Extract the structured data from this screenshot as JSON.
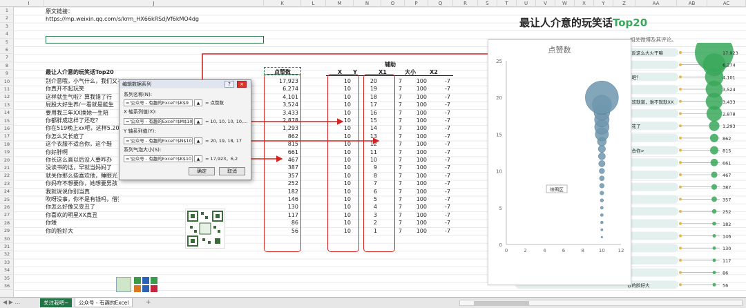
{
  "columns": [
    {
      "label": "I",
      "x": 20,
      "w": 44
    },
    {
      "label": "J",
      "x": 64,
      "w": 318
    },
    {
      "label": "K",
      "x": 382,
      "w": 54
    },
    {
      "label": "L",
      "x": 436,
      "w": 36
    },
    {
      "label": "M",
      "x": 472,
      "w": 40
    },
    {
      "label": "N",
      "x": 512,
      "w": 40
    },
    {
      "label": "O",
      "x": 552,
      "w": 34
    },
    {
      "label": "P",
      "x": 586,
      "w": 34
    },
    {
      "label": "Q",
      "x": 620,
      "w": 36
    },
    {
      "label": "R",
      "x": 656,
      "w": 36
    },
    {
      "label": "S",
      "x": 692,
      "w": 28
    },
    {
      "label": "T",
      "x": 720,
      "w": 28
    },
    {
      "label": "U",
      "x": 748,
      "w": 28
    },
    {
      "label": "V",
      "x": 776,
      "w": 28
    },
    {
      "label": "W",
      "x": 804,
      "w": 28
    },
    {
      "label": "X",
      "x": 832,
      "w": 28
    },
    {
      "label": "Y",
      "x": 860,
      "w": 28
    },
    {
      "label": "Z",
      "x": 888,
      "w": 32
    },
    {
      "label": "AA",
      "x": 920,
      "w": 60
    },
    {
      "label": "AB",
      "x": 980,
      "w": 44
    },
    {
      "label": "AC",
      "x": 1024,
      "w": 56
    }
  ],
  "rows": [
    "1",
    "2",
    "3",
    "4",
    "5",
    "6",
    "7",
    "8",
    "9",
    "10",
    "11",
    "12",
    "13",
    "14",
    "15",
    "16",
    "17",
    "18",
    "19",
    "20",
    "21",
    "22",
    "23",
    "24",
    "25",
    "26",
    "27",
    "28",
    "29",
    "30",
    "31",
    "32",
    "33",
    "34",
    "35",
    "36"
  ],
  "link": {
    "label": "原文链接：",
    "url": "https://mp.weixin.qq.com/s/krm_HX66kRSdjVf6kMO4dg"
  },
  "table": {
    "title": "最让人介意的玩笑话Top20",
    "header_likes": "点赞数",
    "header_aux": "辅助",
    "headers": [
      "X",
      "Y",
      "X1",
      "大小",
      "X2"
    ],
    "rows": [
      {
        "text": "别介意哦，小气什么，我们又不",
        "likes": "17,923",
        "x": "10",
        "y": "20",
        "x1": "7",
        "size": "100",
        "x2": "-7"
      },
      {
        "text": "你真开不起玩笑",
        "likes": "6,274",
        "x": "10",
        "y": "19",
        "x1": "7",
        "size": "100",
        "x2": "-7"
      },
      {
        "text": "这样就生气啦？算我错了行",
        "likes": "4,101",
        "x": "10",
        "y": "18",
        "x1": "7",
        "size": "100",
        "x2": "-7"
      },
      {
        "text": "屁股大好生养/一看就是能生",
        "likes": "3,524",
        "x": "10",
        "y": "17",
        "x1": "7",
        "size": "100",
        "x2": "-7"
      },
      {
        "text": "要用我三年XX换她一生陪",
        "likes": "3,433",
        "x": "10",
        "y": "16",
        "x1": "7",
        "size": "100",
        "x2": "-7"
      },
      {
        "text": "你都胖成这样了还吃？",
        "likes": "2,878",
        "x": "10",
        "y": "15",
        "x1": "7",
        "size": "100",
        "x2": "-7"
      },
      {
        "text": "你在519晚上xx吧，这样5.20",
        "likes": "1,293",
        "x": "10",
        "y": "14",
        "x1": "7",
        "size": "100",
        "x2": "-7"
      },
      {
        "text": "你怎么又长痘了",
        "likes": "862",
        "x": "10",
        "y": "13",
        "x1": "7",
        "size": "100",
        "x2": "-7"
      },
      {
        "text": "这个衣服不适合你，这个鞋",
        "likes": "815",
        "x": "10",
        "y": "12",
        "x1": "7",
        "size": "100",
        "x2": "-7"
      },
      {
        "text": "你好胖啊",
        "likes": "661",
        "x": "10",
        "y": "11",
        "x1": "7",
        "size": "100",
        "x2": "-7"
      },
      {
        "text": "你长这么高以后没人要咋办",
        "likes": "467",
        "x": "10",
        "y": "10",
        "x1": "7",
        "size": "100",
        "x2": "-7"
      },
      {
        "text": "没读书的话，早就当妈妈了",
        "likes": "387",
        "x": "10",
        "y": "9",
        "x1": "7",
        "size": "100",
        "x2": "-7"
      },
      {
        "text": "就关你那么些喜欢他，睡眼光",
        "likes": "357",
        "x": "10",
        "y": "8",
        "x1": "7",
        "size": "100",
        "x2": "-7"
      },
      {
        "text": "你妈咋不想要你，她想要男孩",
        "likes": "252",
        "x": "10",
        "y": "7",
        "x1": "7",
        "size": "100",
        "x2": "-7"
      },
      {
        "text": "我就说说你别当真",
        "likes": "182",
        "x": "10",
        "y": "6",
        "x1": "7",
        "size": "100",
        "x2": "-7"
      },
      {
        "text": "吹呀没事，你不是有钱吗，借我一点又怎样？",
        "likes": "146",
        "x": "10",
        "y": "5",
        "x1": "7",
        "size": "100",
        "x2": "-7"
      },
      {
        "text": "你怎么好像又变丑了",
        "likes": "130",
        "x": "10",
        "y": "4",
        "x1": "7",
        "size": "100",
        "x2": "-7"
      },
      {
        "text": "你喜欢的明星XX真丑",
        "likes": "117",
        "x": "10",
        "y": "3",
        "x1": "7",
        "size": "100",
        "x2": "-7"
      },
      {
        "text": "你矮",
        "likes": "86",
        "x": "10",
        "y": "2",
        "x1": "7",
        "size": "100",
        "x2": "-7"
      },
      {
        "text": "你的脸好大",
        "likes": "56",
        "x": "10",
        "y": "1",
        "x1": "7",
        "size": "100",
        "x2": "-7"
      }
    ]
  },
  "dialog": {
    "title": "编辑数据系列",
    "help": "?",
    "close": "×",
    "series_name_label": "系列名称(N):",
    "series_name_value": "='公众号 - 有趣的Excel'!$K$9",
    "series_name_result": "= 点赞数",
    "x_label": "X 轴系列值(X):",
    "x_value": "='公众号 - 有趣的Excel'!$M$10:",
    "x_result": "= 10, 10, 10, 10,...",
    "y_label": "Y 轴系列值(Y):",
    "y_value": "='公众号 - 有趣的Excel'!$N$10:",
    "y_result": "= 20, 19, 18, 17",
    "size_label": "系列气泡大小(S):",
    "size_value": "='公众号 - 有趣的Excel'!$K$10:",
    "size_result": "= 17,923，6,2",
    "ok": "确定",
    "cancel": "取消"
  },
  "chart_data": {
    "type": "scatter",
    "title": "点赞数",
    "xlabel": "",
    "ylabel": "",
    "xlim": [
      0,
      12
    ],
    "ylim": [
      0,
      25
    ],
    "xticks": [
      "0",
      "2",
      "4",
      "6",
      "8",
      "10",
      "12"
    ],
    "yticks": [
      "0",
      "5",
      "10",
      "15",
      "20",
      "25"
    ],
    "grid": false,
    "tooltip": "绘图区",
    "color": "#6e96ae",
    "points": [
      {
        "x": 10,
        "y": 20,
        "size": 17923
      },
      {
        "x": 10,
        "y": 19,
        "size": 6274
      },
      {
        "x": 10,
        "y": 18,
        "size": 4101
      },
      {
        "x": 10,
        "y": 17,
        "size": 3524
      },
      {
        "x": 10,
        "y": 16,
        "size": 3433
      },
      {
        "x": 10,
        "y": 15,
        "size": 2878
      },
      {
        "x": 10,
        "y": 14,
        "size": 1293
      },
      {
        "x": 10,
        "y": 13,
        "size": 862
      },
      {
        "x": 10,
        "y": 12,
        "size": 815
      },
      {
        "x": 10,
        "y": 11,
        "size": 661
      },
      {
        "x": 10,
        "y": 10,
        "size": 467
      },
      {
        "x": 10,
        "y": 9,
        "size": 387
      },
      {
        "x": 10,
        "y": 8,
        "size": 357
      },
      {
        "x": 10,
        "y": 7,
        "size": 252
      },
      {
        "x": 10,
        "y": 6,
        "size": 182
      },
      {
        "x": 10,
        "y": 5,
        "size": 146
      },
      {
        "x": 10,
        "y": 4,
        "size": 130
      },
      {
        "x": 10,
        "y": 3,
        "size": 117
      },
      {
        "x": 10,
        "y": 2,
        "size": 86
      },
      {
        "x": 10,
        "y": 1,
        "size": 56
      }
    ]
  },
  "right_panel": {
    "title_part1": "最让人介意的玩笑话",
    "title_part2": "Top20",
    "subtitle": "相关微博及其评论。",
    "accent": "#3aa85a",
    "bar_color": "#e3f0ee",
    "bubble_color": "#3aa85a",
    "rows": [
      {
        "label": "友反这么大火干嘛",
        "value": "17,923"
      },
      {
        "label": "",
        "value": "6,274"
      },
      {
        "label": "心吧？",
        "value": "4,101"
      },
      {
        "label": "",
        "value": "3,524"
      },
      {
        "label": "喜欢就道，谁不就就XX",
        "value": "3,433"
      },
      {
        "label": "",
        "value": "2,878"
      },
      {
        "label": "鲜花了",
        "value": "1,293"
      },
      {
        "label": "",
        "value": "862"
      },
      {
        "label": "适合你>",
        "value": "815"
      },
      {
        "label": "",
        "value": "661"
      },
      {
        "label": "",
        "value": "467"
      },
      {
        "label": "",
        "value": "387"
      },
      {
        "label": "",
        "value": "357"
      },
      {
        "label": "",
        "value": "252"
      },
      {
        "label": "",
        "value": "182"
      },
      {
        "label": "",
        "value": "146"
      },
      {
        "label": "",
        "value": "130"
      },
      {
        "label": "",
        "value": "117"
      },
      {
        "label": "",
        "value": "86"
      },
      {
        "label": "你的脸好大",
        "value": "56"
      }
    ]
  },
  "sheet_tabs": {
    "tab1": "关注我吧~",
    "tab2": "公众号 - 有趣的Excel",
    "add": "+"
  }
}
